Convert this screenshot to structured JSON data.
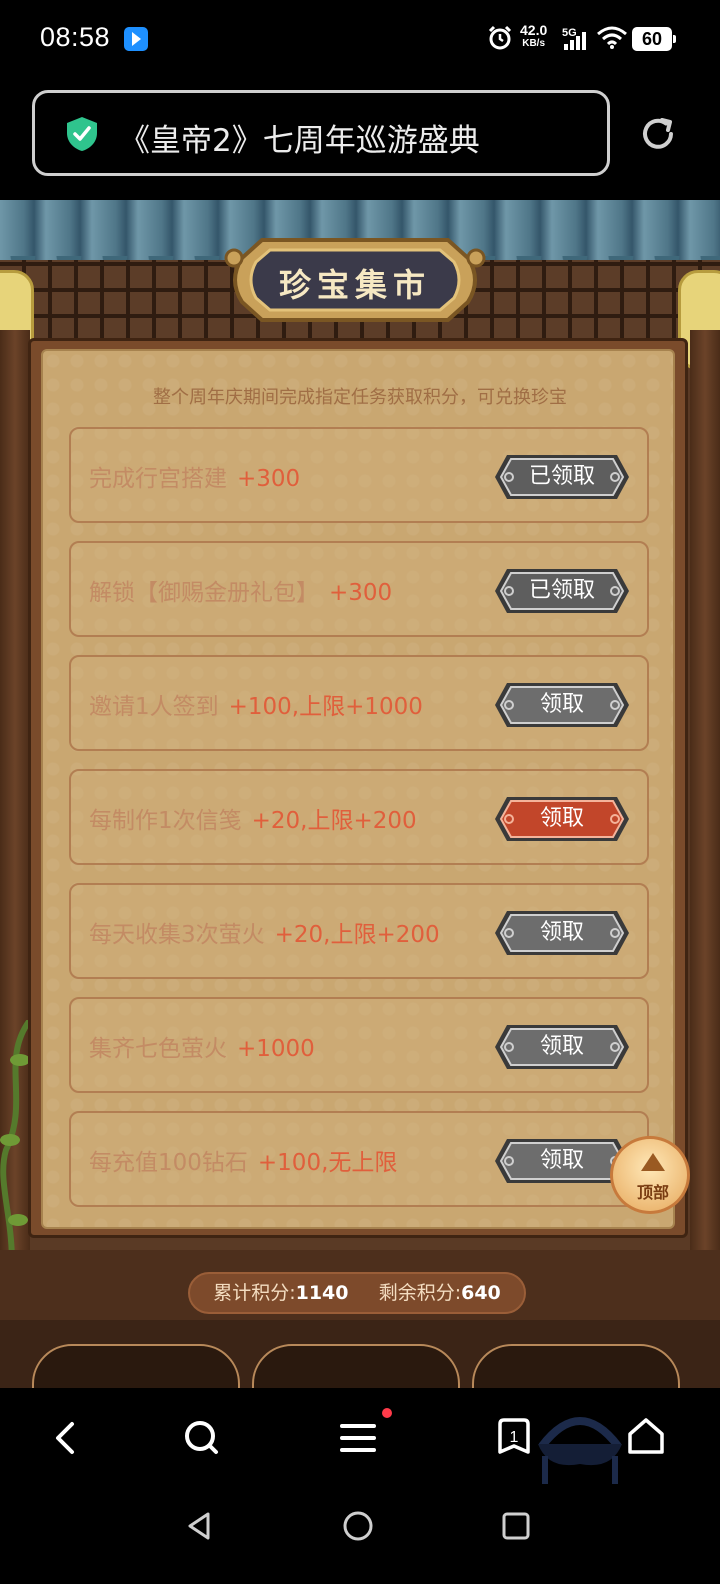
{
  "status_bar": {
    "time": "08:58",
    "net_speed": "42.0",
    "net_unit": "KB/s",
    "network": "5G",
    "battery": "60"
  },
  "browser": {
    "page_title": "《皇帝2》七周年巡游盛典"
  },
  "market": {
    "sign_title": "珍宝集市",
    "intro": "整个周年庆期间完成指定任务获取积分，可兑换珍宝",
    "tasks": [
      {
        "label": "完成行宫搭建",
        "points": "+300",
        "button": "已领取",
        "state": "claimed"
      },
      {
        "label": "解锁【御赐金册礼包】",
        "points": "+300",
        "button": "已领取",
        "state": "claimed"
      },
      {
        "label": "邀请1人签到",
        "points": "+100,上限+1000",
        "button": "领取",
        "state": "inactive"
      },
      {
        "label": "每制作1次信笺",
        "points": "+20,上限+200",
        "button": "领取",
        "state": "active"
      },
      {
        "label": "每天收集3次萤火",
        "points": "+20,上限+200",
        "button": "领取",
        "state": "inactive"
      },
      {
        "label": "集齐七色萤火",
        "points": "+1000",
        "button": "领取",
        "state": "inactive"
      },
      {
        "label": "每充值100钻石",
        "points": "+100,无上限",
        "button": "领取",
        "state": "inactive"
      }
    ],
    "score": {
      "total_label": "累计积分:",
      "total_value": "1140",
      "remaining_label": "剩余积分:",
      "remaining_value": "640"
    },
    "top_button": "顶部"
  },
  "bottom_nav": {
    "tab_count": "1",
    "icons": [
      "back-icon",
      "search-icon",
      "menu-icon",
      "tabs-icon",
      "home-icon"
    ]
  },
  "colors": {
    "points_red": "#e05f3c",
    "task_text": "#c38b64",
    "active_button": "#c2462a",
    "inactive_button": "#6d6d6d",
    "panel_bg": "#c9a771"
  }
}
